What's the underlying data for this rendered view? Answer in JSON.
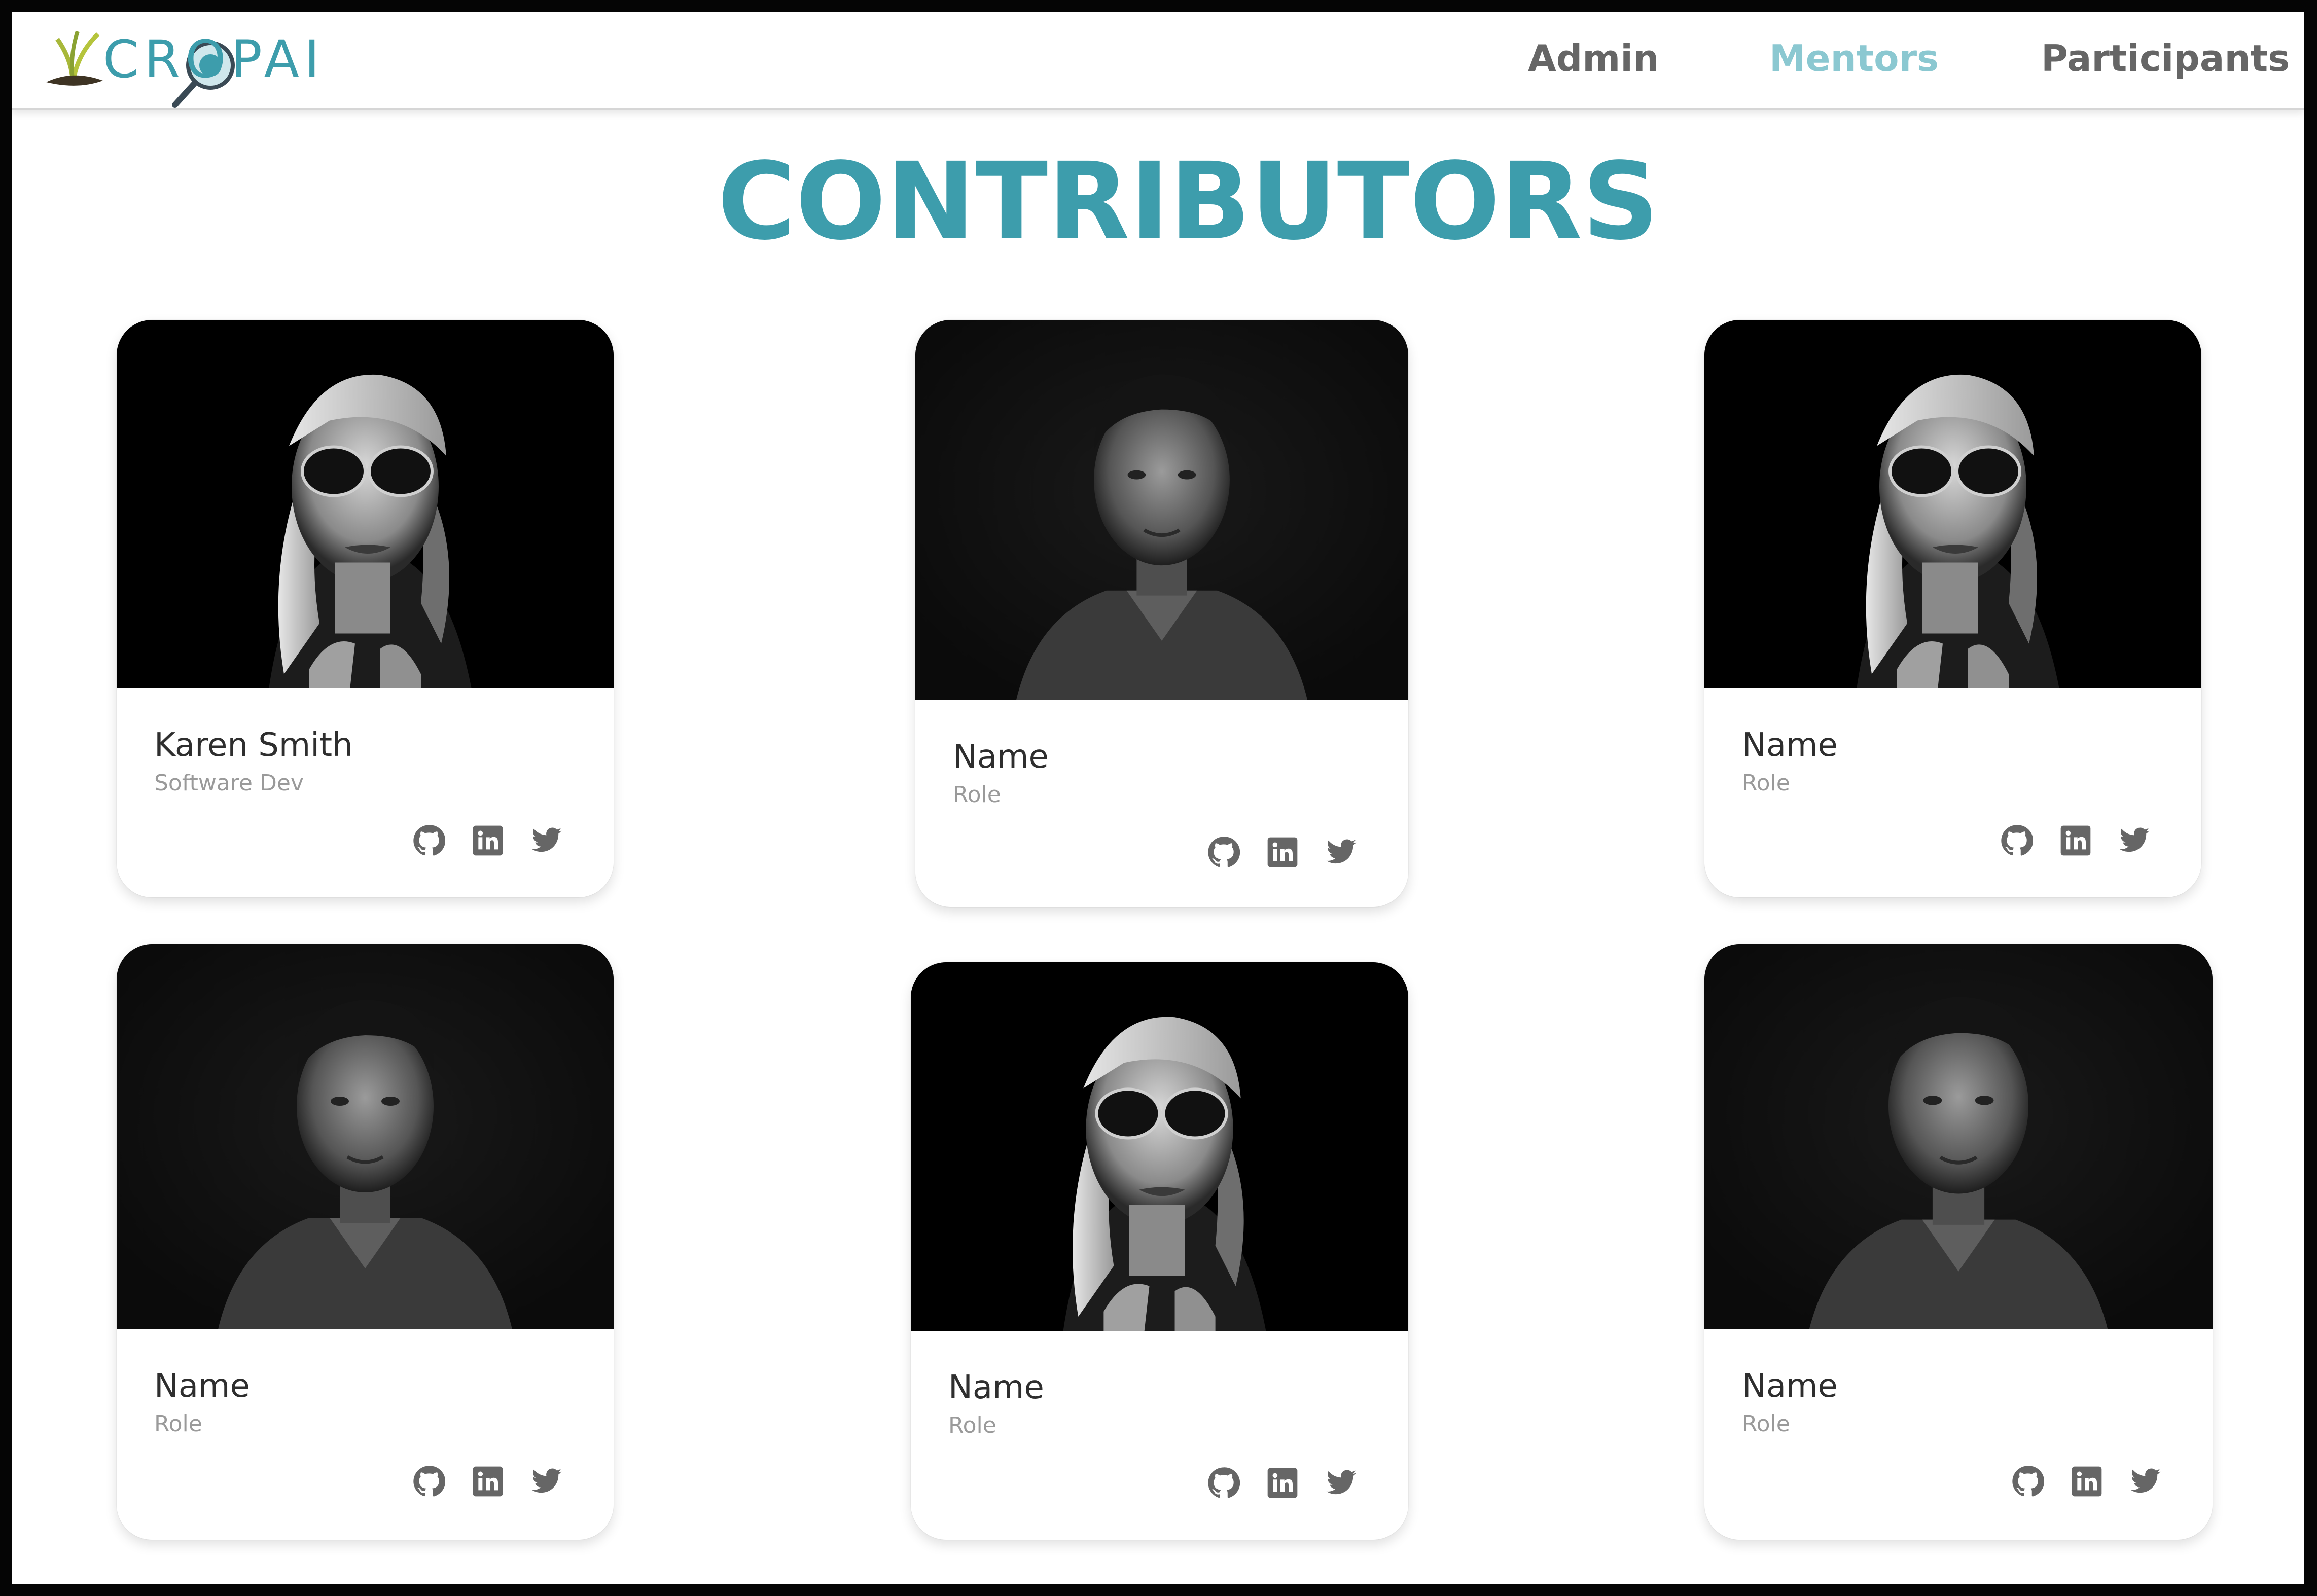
{
  "brand": {
    "logo_text": "CROPAI",
    "accent": "#3d9dac"
  },
  "nav": {
    "items": [
      {
        "label": "Admin",
        "active": false
      },
      {
        "label": "Mentors",
        "active": true
      },
      {
        "label": "Participants",
        "active": false
      }
    ]
  },
  "page": {
    "title": "CONTRIBUTORS"
  },
  "contributors": [
    {
      "name": "Karen Smith",
      "role": "Software Dev",
      "photo": "woman-sunglasses-portrait"
    },
    {
      "name": "Name",
      "role": "Role",
      "photo": "man-portrait"
    },
    {
      "name": "Name",
      "role": "Role",
      "photo": "woman-sunglasses-portrait"
    },
    {
      "name": "Name",
      "role": "Role",
      "photo": "man-portrait"
    },
    {
      "name": "Name",
      "role": "Role",
      "photo": "woman-sunglasses-portrait"
    },
    {
      "name": "Name",
      "role": "Role",
      "photo": "man-portrait"
    }
  ],
  "social_icons": [
    "github-icon",
    "linkedin-icon",
    "twitter-icon"
  ]
}
